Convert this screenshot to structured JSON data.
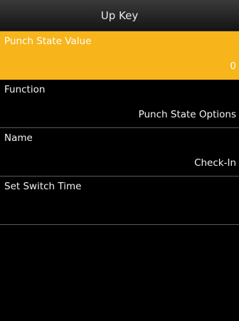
{
  "header": {
    "title": "Up Key"
  },
  "menu": {
    "items": [
      {
        "label": "Punch State Value",
        "value": "0"
      },
      {
        "label": "Function",
        "value": "Punch State Options"
      },
      {
        "label": "Name",
        "value": "Check-In"
      },
      {
        "label": "Set Switch Time",
        "value": ""
      }
    ],
    "selected_index": 0
  },
  "colors": {
    "highlight": "#f7b51b",
    "background": "#000000",
    "text": "#ffffff",
    "divider": "#5a5a5a"
  }
}
